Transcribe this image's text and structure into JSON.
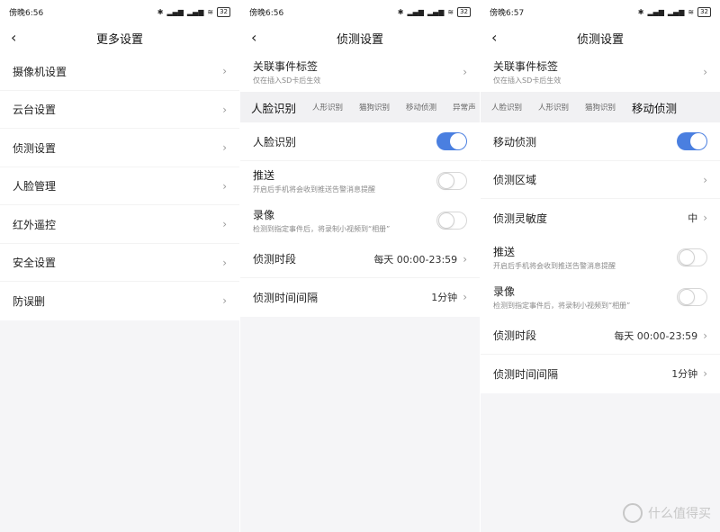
{
  "screen1": {
    "time": "傍晚6:56",
    "battery": "32",
    "title": "更多设置",
    "items": [
      {
        "label": "摄像机设置"
      },
      {
        "label": "云台设置"
      },
      {
        "label": "侦测设置"
      },
      {
        "label": "人脸管理"
      },
      {
        "label": "红外遥控"
      },
      {
        "label": "安全设置"
      },
      {
        "label": "防误删"
      }
    ]
  },
  "screen2": {
    "time": "傍晚6:56",
    "battery": "32",
    "title": "侦测设置",
    "event_tag": {
      "label": "关联事件标签",
      "sub": "仅在插入SD卡后生效"
    },
    "tabs": [
      "人脸识别",
      "人形识别",
      "猫狗识别",
      "移动侦测",
      "异常声"
    ],
    "active_tab": "人脸识别",
    "toggle_row": {
      "label": "人脸识别",
      "state": "on"
    },
    "push": {
      "label": "推送",
      "sub": "开启后手机将会收到推送告警消息提醒",
      "state": "off"
    },
    "record": {
      "label": "录像",
      "sub": "检测到指定事件后，将录制小视频到“相册”",
      "state": "off"
    },
    "period": {
      "label": "侦测时段",
      "value": "每天 00:00-23:59"
    },
    "interval": {
      "label": "侦测时间间隔",
      "value": "1分钟"
    }
  },
  "screen3": {
    "time": "傍晚6:57",
    "battery": "32",
    "title": "侦测设置",
    "event_tag": {
      "label": "关联事件标签",
      "sub": "仅在插入SD卡后生效"
    },
    "tabs": [
      "人脸识别",
      "人形识别",
      "猫狗识别",
      "移动侦测"
    ],
    "active_tab": "移动侦测",
    "toggle_row": {
      "label": "移动侦测",
      "state": "on"
    },
    "zone": {
      "label": "侦测区域"
    },
    "sensitivity": {
      "label": "侦测灵敏度",
      "value": "中"
    },
    "push": {
      "label": "推送",
      "sub": "开启后手机将会收到推送告警消息提醒",
      "state": "off"
    },
    "record": {
      "label": "录像",
      "sub": "检测到指定事件后，将录制小视频到“相册”",
      "state": "off"
    },
    "period": {
      "label": "侦测时段",
      "value": "每天 00:00-23:59"
    },
    "interval": {
      "label": "侦测时间间隔",
      "value": "1分钟"
    }
  },
  "watermark": {
    "text": "什么值得买"
  },
  "colors": {
    "accent": "#4a7fe0",
    "background": "#f5f5f7",
    "card": "#ffffff"
  }
}
